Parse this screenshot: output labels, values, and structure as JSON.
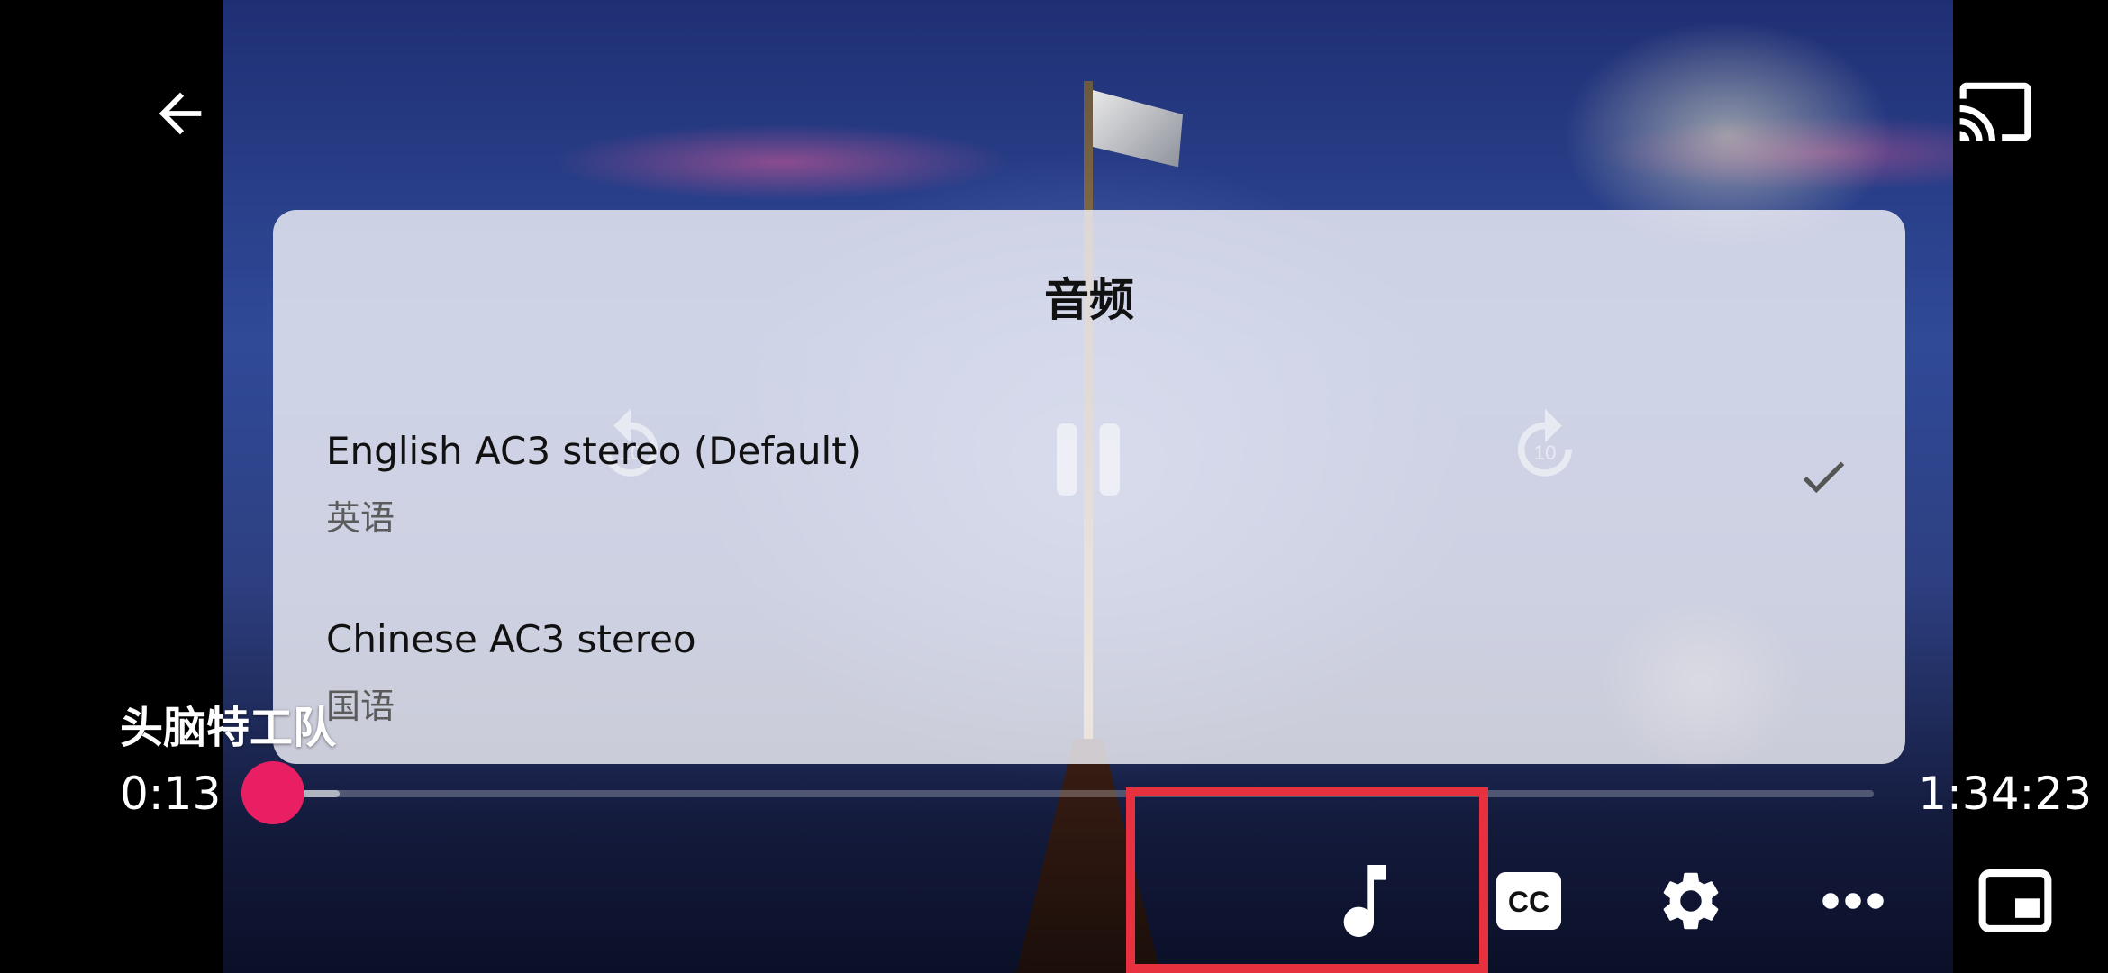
{
  "video": {
    "title": "头脑特工队",
    "current_time": "0:13",
    "total_time": "1:34:23",
    "progress": 0.011,
    "buffered": 0.06
  },
  "audio_dialog": {
    "title": "音频",
    "tracks": [
      {
        "name": "English AC3 stereo (Default)",
        "language": "英语",
        "selected": true
      },
      {
        "name": "Chinese AC3 stereo",
        "language": "国语",
        "selected": false
      }
    ]
  },
  "icons": {
    "back": "arrow-back-icon",
    "cast": "cast-icon",
    "check": "check-icon",
    "rewind": "replay-10-icon",
    "rewind_label": "10",
    "pause": "pause-icon",
    "forward": "forward-10-icon",
    "forward_label": "10",
    "audio": "music-note-icon",
    "cc": "closed-captions-icon",
    "cc_label": "CC",
    "settings": "gear-icon",
    "more": "more-horizontal-icon",
    "pip": "picture-in-picture-icon"
  },
  "colors": {
    "accent": "#e91e63",
    "highlight": "#e8313f"
  }
}
